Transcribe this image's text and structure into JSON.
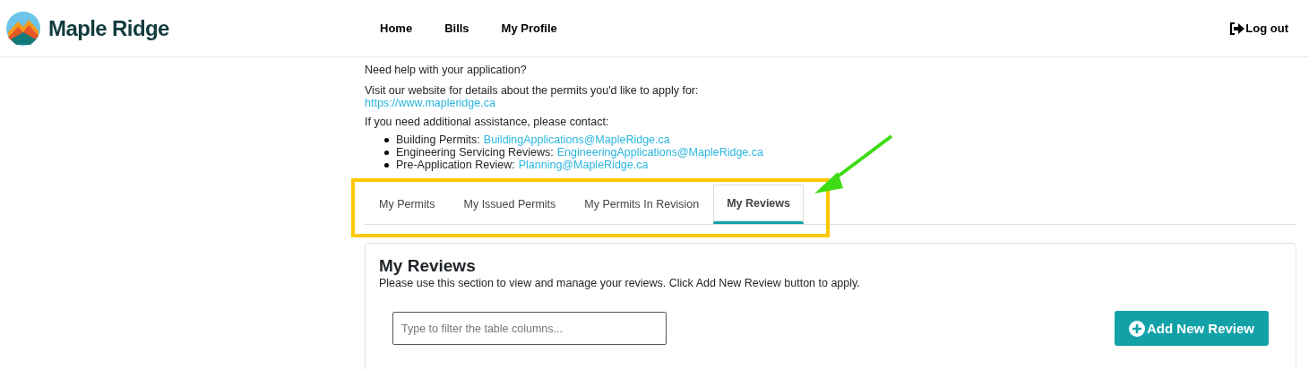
{
  "header": {
    "brand": "Maple Ridge",
    "nav": [
      "Home",
      "Bills",
      "My Profile"
    ],
    "logout": "Log out"
  },
  "help": {
    "title": "Need help with your application?",
    "website_text": "Visit our website for details about the permits you'd like to apply for:",
    "website_link": "https://www.mapleridge.ca",
    "contact_text": "If you need additional assistance, please contact:",
    "contacts": [
      {
        "label": "Building Permits:",
        "email": "BuildingApplications@MapleRidge.ca"
      },
      {
        "label": "Engineering Servicing Reviews:",
        "email": "EngineeringApplications@MapleRidge.ca"
      },
      {
        "label": "Pre-Application Review:",
        "email": "Planning@MapleRidge.ca"
      }
    ]
  },
  "tabs": [
    {
      "label": "My Permits",
      "selected": false
    },
    {
      "label": "My Issued Permits",
      "selected": false
    },
    {
      "label": "My Permits In Revision",
      "selected": false
    },
    {
      "label": "My Reviews",
      "selected": true
    }
  ],
  "panel": {
    "title": "My Reviews",
    "description": "Please use this section to view and manage your reviews. Click Add New Review button to apply.",
    "filter": {
      "placeholder": "Type to filter the table columns..."
    },
    "add_button": "Add New Review"
  }
}
